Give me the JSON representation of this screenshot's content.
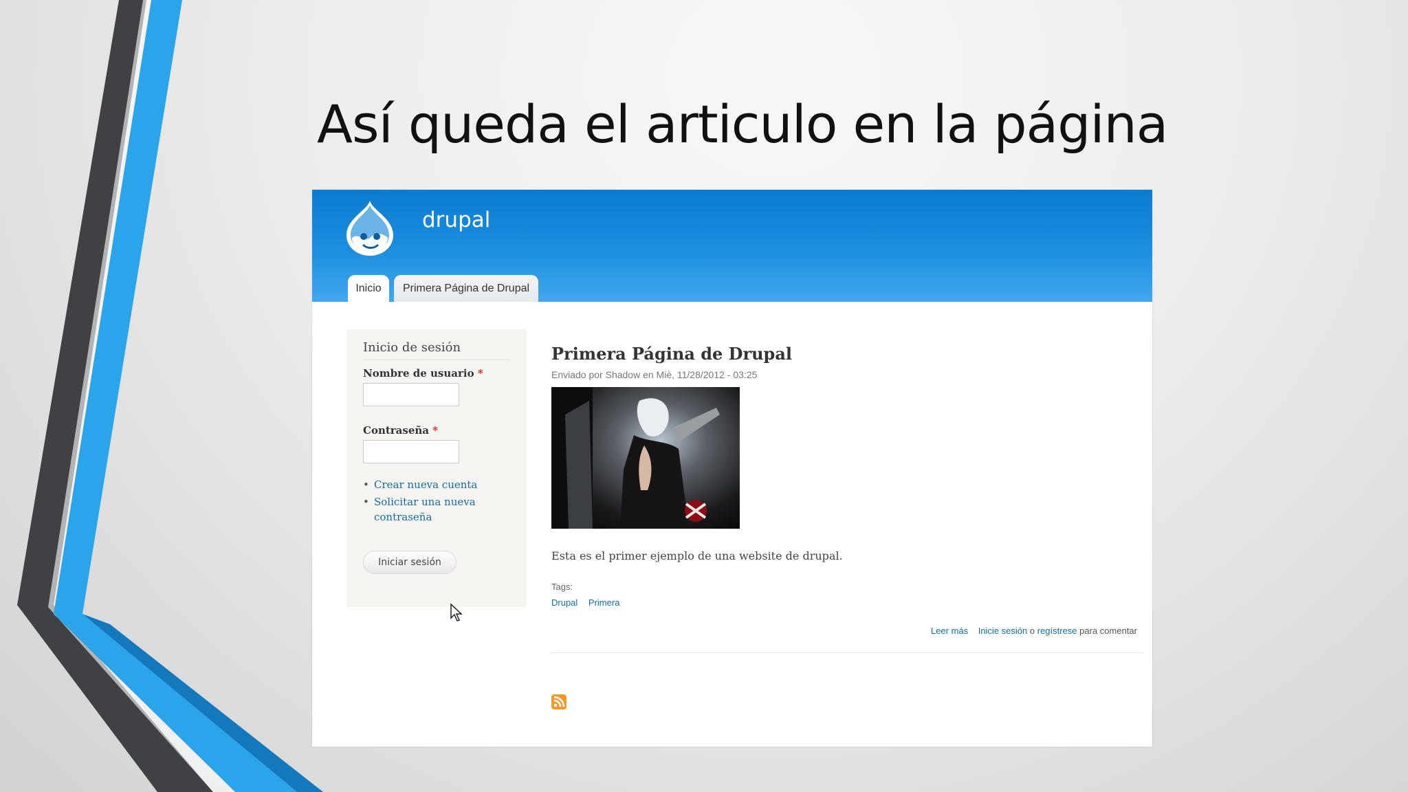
{
  "slide": {
    "title": "Así queda el articulo en la página"
  },
  "site": {
    "name": "drupal"
  },
  "tabs": [
    {
      "label": "Inicio"
    },
    {
      "label": "Primera Página de Drupal"
    }
  ],
  "login": {
    "title": "Inicio de sesión",
    "username_label": "Nombre de usuario",
    "password_label": "Contraseña",
    "required_mark": "*",
    "username_value": "",
    "password_value": "",
    "links": [
      "Crear nueva cuenta",
      "Solicitar una nueva contraseña"
    ],
    "submit_label": "Iniciar sesión"
  },
  "article": {
    "title": "Primera Página de Drupal",
    "submitted": "Enviado por Shadow en Miè, 11/28/2012 - 03:25",
    "body": "Esta es el primer ejemplo de una website de drupal.",
    "tags_label": "Tags:",
    "tags": [
      "Drupal",
      "Primera"
    ],
    "read_more": "Leer más",
    "login_link": "Inicie sesión",
    "or_text": "o",
    "register_link": "regístrese",
    "comment_suffix": "para comentar"
  },
  "icons": {
    "logo": "drupal-drop-logo",
    "feed": "rss-icon",
    "cursor": "mouse-pointer-icon"
  },
  "colors": {
    "header_blue": "#0b7bd0",
    "link_blue": "#0f6cb3",
    "accent_blue": "#29a3e6",
    "accent_gray": "#4a4a4a"
  }
}
